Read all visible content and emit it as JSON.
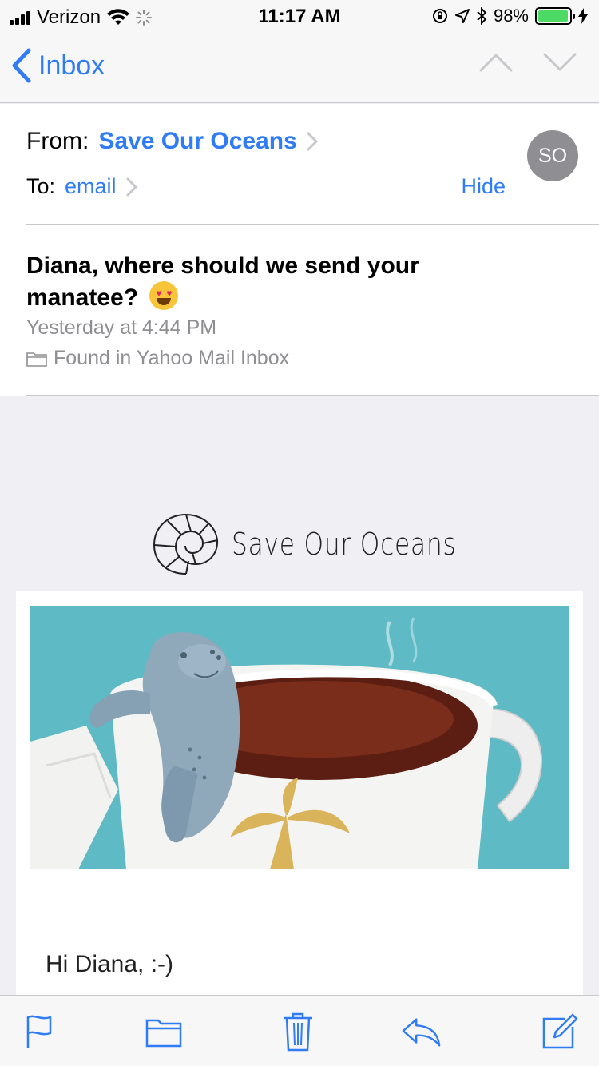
{
  "status_bar": {
    "carrier": "Verizon",
    "time": "11:17 AM",
    "battery_percent": "98%",
    "battery_level": 0.98
  },
  "nav": {
    "back_label": "Inbox"
  },
  "header": {
    "from_label": "From:",
    "from_name": "Save Our Oceans",
    "to_label": "To:",
    "to_value": "email",
    "hide_label": "Hide",
    "avatar_initials": "SO",
    "subject": "Diana, where should we send your manatee?",
    "date": "Yesterday at 4:44 PM",
    "folder": "Found in Yahoo Mail Inbox"
  },
  "body": {
    "logo_text": "Save Our Oceans",
    "greeting": "Hi Diana, :-)"
  },
  "colors": {
    "accent": "#2f7cf6",
    "hero_bg": "#5ebac4",
    "secondary_text": "#8e8e93"
  }
}
